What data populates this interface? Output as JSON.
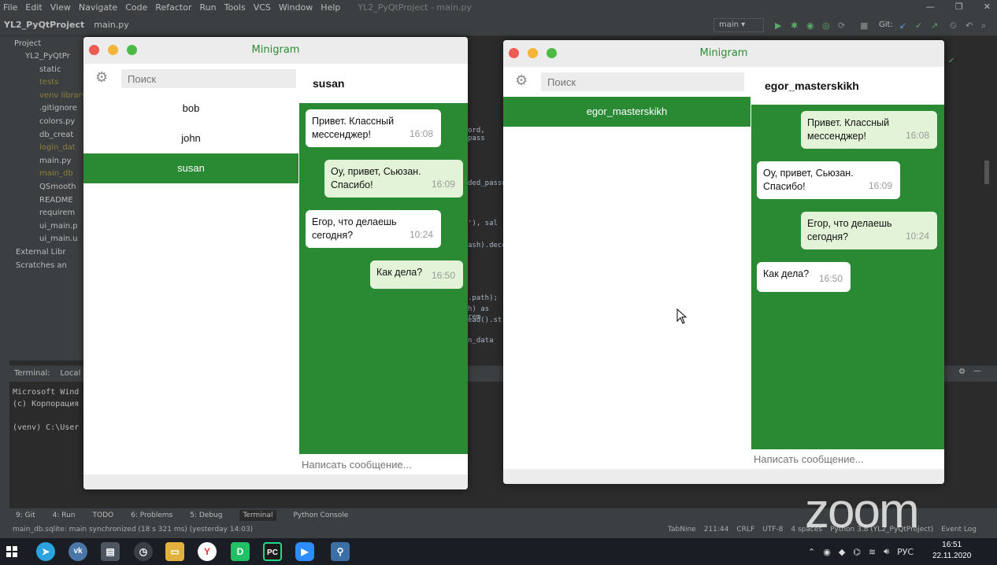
{
  "ide": {
    "menu": [
      "File",
      "Edit",
      "View",
      "Navigate",
      "Code",
      "Refactor",
      "Run",
      "Tools",
      "VCS",
      "Window",
      "Help"
    ],
    "window_title": "YL2_PyQtProject - main.py",
    "project_name": "YL2_PyQtProject",
    "file_tab": "main.py",
    "branch": "main",
    "git_label": "Git:",
    "project_panel_title": "Project",
    "tree": [
      {
        "label": "YL2_PyQtPr",
        "kind": "dir"
      },
      {
        "label": "static",
        "kind": "dir"
      },
      {
        "label": "tests",
        "kind": "dim"
      },
      {
        "label": "venv library",
        "kind": "dim"
      },
      {
        "label": ".gitignore",
        "kind": "file"
      },
      {
        "label": "colors.py",
        "kind": "file"
      },
      {
        "label": "db_creat",
        "kind": "file"
      },
      {
        "label": "login_dat",
        "kind": "dim"
      },
      {
        "label": "main.py",
        "kind": "file"
      },
      {
        "label": "main_db",
        "kind": "dim"
      },
      {
        "label": "QSmooth",
        "kind": "file"
      },
      {
        "label": "README",
        "kind": "file"
      },
      {
        "label": "requirem",
        "kind": "file"
      },
      {
        "label": "ui_main.p",
        "kind": "file"
      },
      {
        "label": "ui_main.u",
        "kind": "file"
      },
      {
        "label": "External Libr",
        "kind": "dir"
      },
      {
        "label": "Scratches an",
        "kind": "dir"
      }
    ],
    "code_fragments": [
      "ord, pass",
      "ded_passw",
      "'), sal",
      "ash).deco",
      ".path);",
      "h) as rem",
      "ead().str",
      "n_data"
    ],
    "terminal": {
      "tab_label": "Terminal:",
      "tab_local": "Local",
      "lines": [
        "Microsoft Wind",
        "(c) Корпорация",
        "",
        "(venv) C:\\User"
      ]
    },
    "bottom_tabs": [
      "9: Git",
      "4: Run",
      "TODO",
      "6: Problems",
      "5: Debug",
      "Terminal",
      "Python Console"
    ],
    "status_text": "main_db.sqlite: main synchronized (18 s 321 ms) (yesterday 14:03)",
    "status_right": [
      "TabNine",
      "211:44",
      "CRLF",
      "UTF-8",
      "4 spaces",
      "Python 3.8 (YL2_PyQtProject)",
      "Event Log"
    ]
  },
  "window1": {
    "title": "Minigram",
    "search_placeholder": "Поиск",
    "contacts": [
      {
        "name": "bob",
        "active": false
      },
      {
        "name": "john",
        "active": false
      },
      {
        "name": "susan",
        "active": true
      }
    ],
    "chat_title": "susan",
    "messages": [
      {
        "text": "Привет. Классный мессенджер!",
        "time": "16:08",
        "dir": "in"
      },
      {
        "text": "Оу, привет, Сьюзан. Спасибо!",
        "time": "16:09",
        "dir": "out"
      },
      {
        "text": "Егор, что делаешь сегодня?",
        "time": "10:24",
        "dir": "in"
      },
      {
        "text": "Как дела?",
        "time": "16:50",
        "dir": "out"
      }
    ],
    "composer_placeholder": "Написать сообщение..."
  },
  "window2": {
    "title": "Minigram",
    "search_placeholder": "Поиск",
    "contacts": [
      {
        "name": "egor_masterskikh",
        "active": true
      }
    ],
    "chat_title": "egor_masterskikh",
    "messages": [
      {
        "text": "Привет. Классный мессенджер!",
        "time": "16:08",
        "dir": "out"
      },
      {
        "text": "Оу, привет, Сьюзан. Спасибо!",
        "time": "16:09",
        "dir": "in"
      },
      {
        "text": "Егор, что делаешь сегодня?",
        "time": "10:24",
        "dir": "out"
      },
      {
        "text": "Как дела?",
        "time": "16:50",
        "dir": "in"
      }
    ],
    "composer_placeholder": "Написать сообщение..."
  },
  "watermark": "zoom",
  "taskbar": {
    "language": "РУС",
    "time": "16:51",
    "date": "22.11.2020"
  },
  "colors": {
    "accent_green": "#2a8a34",
    "title_green": "#2e8b34",
    "outgoing_bubble": "#e3f3d7",
    "incoming_bubble": "#ffffff"
  },
  "icons": [
    "gear-icon",
    "windows-start-icon",
    "telegram-icon",
    "vk-icon",
    "yandex-icon",
    "pycharm-icon",
    "zoom-icon",
    "python-icon",
    "cursor-icon"
  ]
}
